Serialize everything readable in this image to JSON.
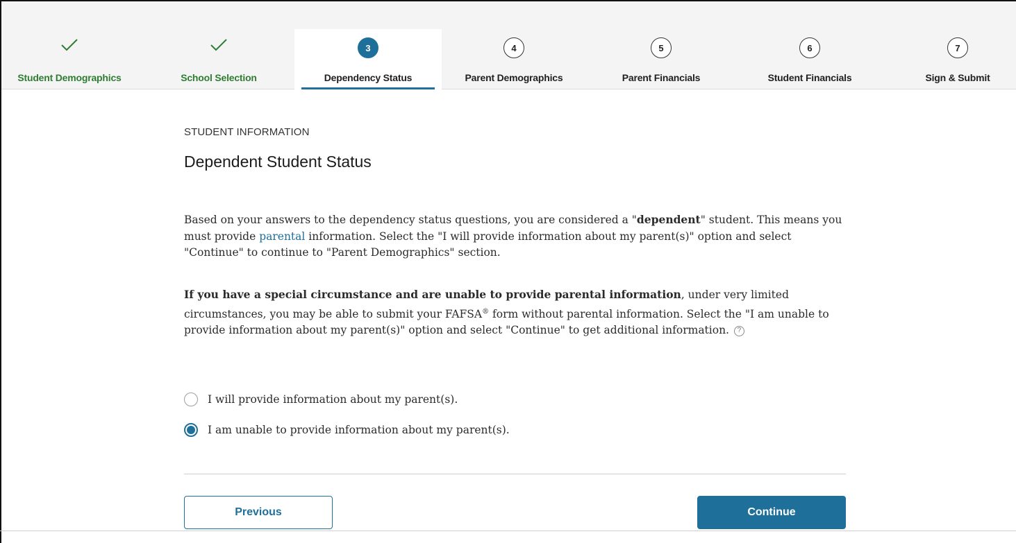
{
  "stepper": {
    "steps": [
      {
        "label": "Student Demographics",
        "state": "complete",
        "icon": "check-icon"
      },
      {
        "label": "School Selection",
        "state": "complete",
        "icon": "check-icon"
      },
      {
        "label": "Dependency Status",
        "state": "current",
        "number": "3"
      },
      {
        "label": "Parent Demographics",
        "state": "upcoming",
        "number": "4"
      },
      {
        "label": "Parent Financials",
        "state": "upcoming",
        "number": "5"
      },
      {
        "label": "Student Financials",
        "state": "upcoming",
        "number": "6"
      },
      {
        "label": "Sign & Submit",
        "state": "upcoming",
        "number": "7"
      }
    ]
  },
  "main": {
    "section_label": "STUDENT INFORMATION",
    "title": "Dependent Student Status",
    "paragraph1": {
      "part1": "Based on your answers to the dependency status questions, you are considered a \"",
      "bold": "dependent",
      "part2": "\" student. This means you must provide ",
      "link": "parental",
      "part3": " information. Select the \"I will provide information about my parent(s)\" option and select \"Continue\" to continue to \"Parent Demographics\" section."
    },
    "paragraph2": {
      "bold": "If you have a special circumstance and are unable to provide parental information",
      "part1": ", under very limited circumstances, you may be able to submit your FAFSA",
      "sup": "®",
      "part2": " form without parental information. Select the \"I am unable to provide information about my parent(s)\" option and select \"Continue\" to get additional information.",
      "help_icon": "?"
    },
    "options": [
      {
        "label": "I will provide information about my parent(s).",
        "checked": false
      },
      {
        "label": "I am unable to provide information about my parent(s).",
        "checked": true
      }
    ],
    "buttons": {
      "previous": "Previous",
      "continue": "Continue"
    }
  },
  "colors": {
    "primary": "#1f6f9b",
    "complete": "#2e7d32"
  }
}
